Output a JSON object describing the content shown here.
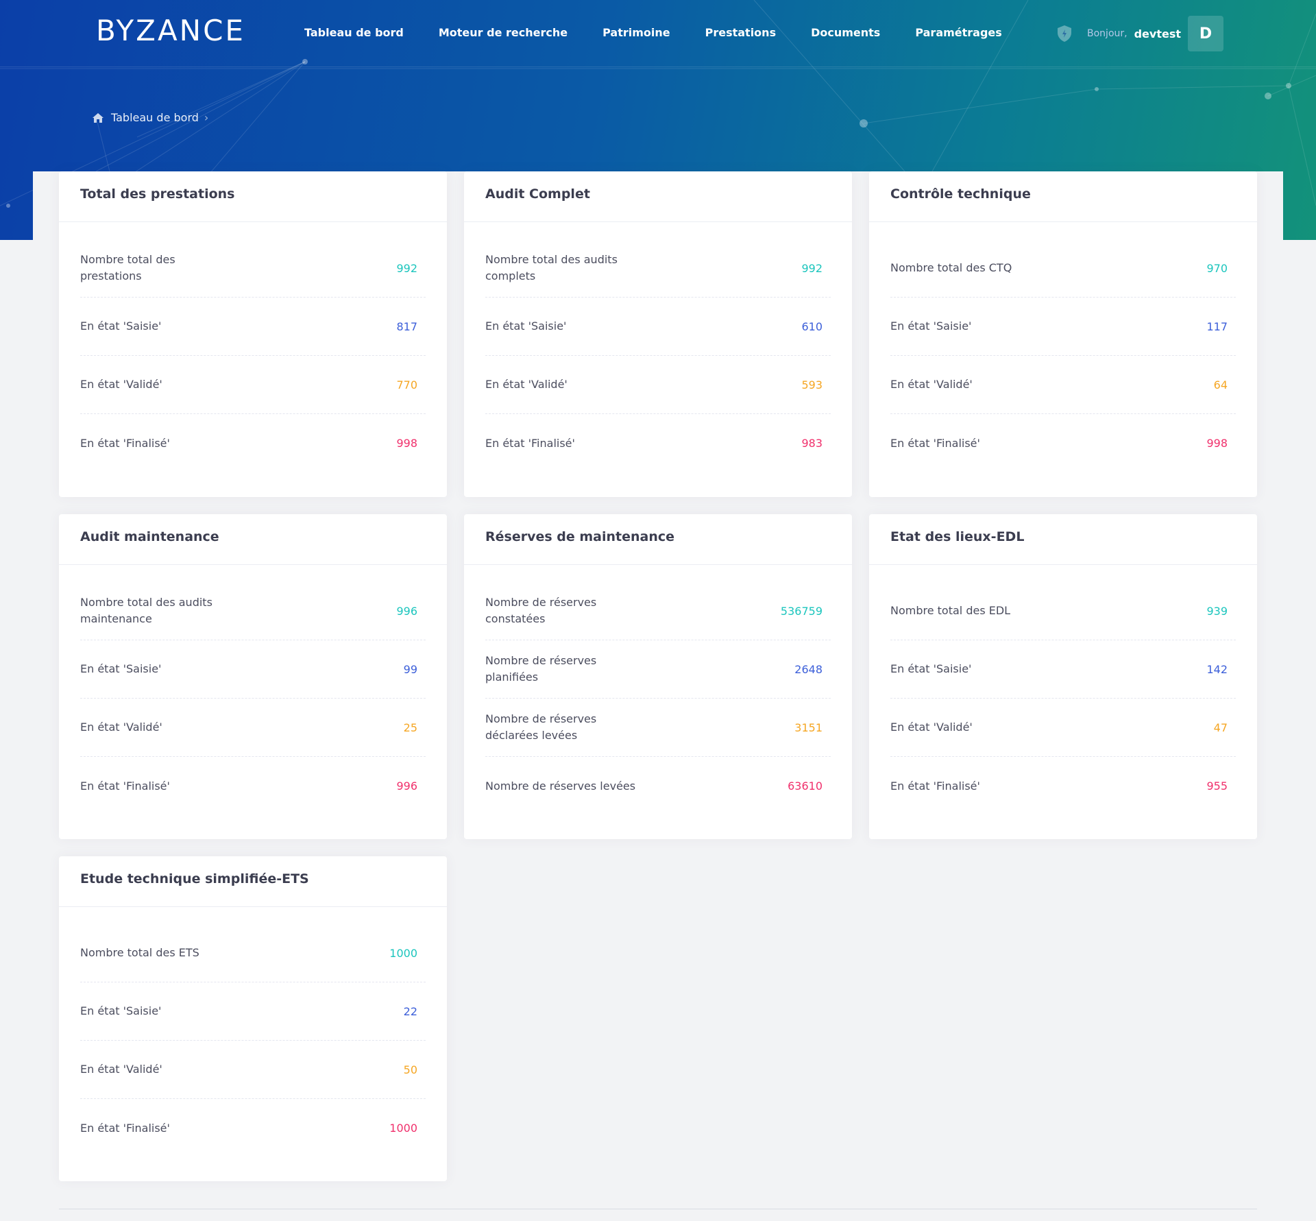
{
  "app": {
    "logo": "BYZANCE",
    "nav": [
      "Tableau de bord",
      "Moteur de recherche",
      "Patrimoine",
      "Prestations",
      "Documents",
      "Paramétrages"
    ],
    "greeting": "Bonjour,",
    "username": "devtest",
    "avatar_initial": "D"
  },
  "breadcrumb": {
    "current": "Tableau de bord"
  },
  "colors": {
    "teal": "#1bc5bd",
    "blue": "#3c5fd9",
    "orange": "#f5a623",
    "pink": "#f0306c"
  },
  "cards": [
    {
      "title": "Total des prestations",
      "rows": [
        {
          "label": "Nombre total des prestations",
          "value": "992"
        },
        {
          "label": "En état 'Saisie'",
          "value": "817"
        },
        {
          "label": "En état 'Validé'",
          "value": "770"
        },
        {
          "label": "En état 'Finalisé'",
          "value": "998"
        }
      ]
    },
    {
      "title": "Audit Complet",
      "rows": [
        {
          "label": "Nombre total des audits complets",
          "value": "992"
        },
        {
          "label": "En état 'Saisie'",
          "value": "610"
        },
        {
          "label": "En état 'Validé'",
          "value": "593"
        },
        {
          "label": "En état 'Finalisé'",
          "value": "983"
        }
      ]
    },
    {
      "title": "Contrôle technique",
      "rows": [
        {
          "label": "Nombre total des CTQ",
          "value": "970"
        },
        {
          "label": "En état 'Saisie'",
          "value": "117"
        },
        {
          "label": "En état 'Validé'",
          "value": "64"
        },
        {
          "label": "En état 'Finalisé'",
          "value": "998"
        }
      ]
    },
    {
      "title": "Audit maintenance",
      "rows": [
        {
          "label": "Nombre total des audits maintenance",
          "value": "996"
        },
        {
          "label": "En état 'Saisie'",
          "value": "99"
        },
        {
          "label": "En état 'Validé'",
          "value": "25"
        },
        {
          "label": "En état 'Finalisé'",
          "value": "996"
        }
      ]
    },
    {
      "title": "Réserves de maintenance",
      "rows": [
        {
          "label": "Nombre de réserves constatées",
          "value": "536759"
        },
        {
          "label": "Nombre de réserves planifiées",
          "value": "2648"
        },
        {
          "label": "Nombre de réserves déclarées levées",
          "value": "3151"
        },
        {
          "label": "Nombre de réserves levées",
          "value": "63610"
        }
      ]
    },
    {
      "title": "Etat des lieux-EDL",
      "rows": [
        {
          "label": "Nombre total des EDL",
          "value": "939"
        },
        {
          "label": "En état 'Saisie'",
          "value": "142"
        },
        {
          "label": "En état 'Validé'",
          "value": "47"
        },
        {
          "label": "En état 'Finalisé'",
          "value": "955"
        }
      ]
    },
    {
      "title": "Etude technique simplifiée-ETS",
      "rows": [
        {
          "label": "Nombre total des ETS",
          "value": "1000"
        },
        {
          "label": "En état 'Saisie'",
          "value": "22"
        },
        {
          "label": "En état 'Validé'",
          "value": "50"
        },
        {
          "label": "En état 'Finalisé'",
          "value": "1000"
        }
      ]
    }
  ]
}
